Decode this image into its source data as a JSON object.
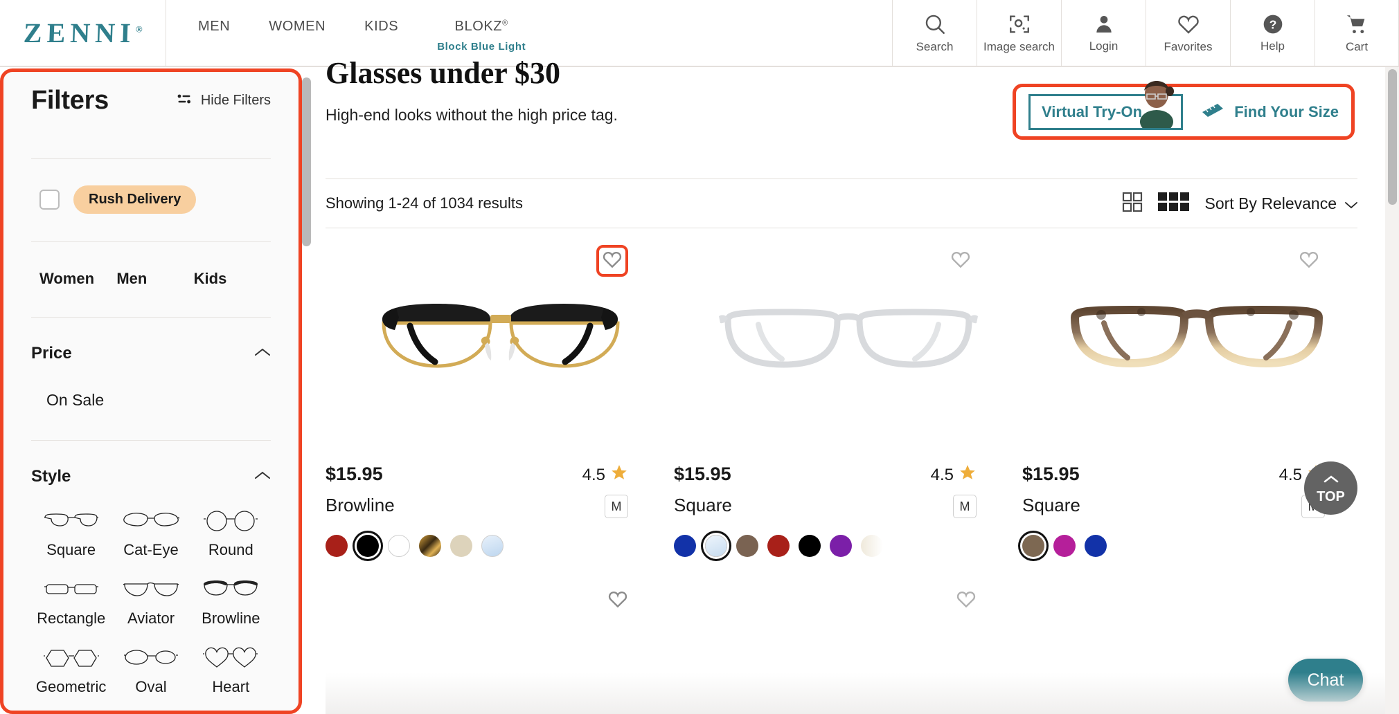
{
  "header": {
    "logo": "ZENNI",
    "logo_mark": "registered-trademark",
    "nav": [
      {
        "label": "MEN",
        "sub": ""
      },
      {
        "label": "WOMEN",
        "sub": ""
      },
      {
        "label": "KIDS",
        "sub": ""
      },
      {
        "label": "BLOKZ",
        "sup": "®",
        "sub": "Block Blue Light"
      }
    ],
    "actions": [
      {
        "label": "Search",
        "icon": "search-icon"
      },
      {
        "label": "Image search",
        "icon": "image-search-icon"
      },
      {
        "label": "Login",
        "icon": "user-icon"
      },
      {
        "label": "Favorites",
        "icon": "heart-icon"
      },
      {
        "label": "Help",
        "icon": "help-circle-icon"
      },
      {
        "label": "Cart",
        "icon": "cart-icon"
      }
    ]
  },
  "sidebar": {
    "title": "Filters",
    "hide_label": "Hide Filters",
    "rush": {
      "label": "Rush Delivery",
      "checked": false
    },
    "genders": [
      "Women",
      "Men",
      "Kids"
    ],
    "sections": [
      {
        "title": "Price",
        "expanded": true,
        "options": [
          "On Sale"
        ]
      },
      {
        "title": "Style",
        "expanded": true
      }
    ],
    "styles": [
      {
        "label": "Square",
        "icon": "glasses-square-icon"
      },
      {
        "label": "Cat-Eye",
        "icon": "glasses-cateye-icon"
      },
      {
        "label": "Round",
        "icon": "glasses-round-icon"
      },
      {
        "label": "Rectangle",
        "icon": "glasses-rectangle-icon"
      },
      {
        "label": "Aviator",
        "icon": "glasses-aviator-icon"
      },
      {
        "label": "Browline",
        "icon": "glasses-browline-icon"
      },
      {
        "label": "Geometric",
        "icon": "glasses-geometric-icon"
      },
      {
        "label": "Oval",
        "icon": "glasses-oval-icon"
      },
      {
        "label": "Heart",
        "icon": "glasses-heart-icon"
      }
    ]
  },
  "main": {
    "title": "Glasses under $30",
    "subtitle": "High-end looks without the high price tag.",
    "virtual_try_on": "Virtual Try-On",
    "find_your_size": "Find Your Size",
    "results_text": "Showing 1-24 of 1034 results",
    "sort_label": "Sort By Relevance",
    "view_modes": [
      "grid-2-icon",
      "grid-3-icon"
    ]
  },
  "products": [
    {
      "price": "$15.95",
      "rating": "4.5",
      "shape": "Browline",
      "size": "M",
      "favorited": false,
      "highlighted": true,
      "frame": "browline-black-gold",
      "colors": [
        {
          "hex": "#a82019",
          "selected": false
        },
        {
          "hex": "#000000",
          "selected": true
        },
        {
          "hex": "#ffffff",
          "selected": false
        },
        {
          "hex": "#c99536",
          "selected": false
        },
        {
          "hex": "#ddd3bb",
          "selected": false
        },
        {
          "hex": "#cfe2f3",
          "selected": false
        }
      ]
    },
    {
      "price": "$15.95",
      "rating": "4.5",
      "shape": "Square",
      "size": "M",
      "favorited": false,
      "highlighted": false,
      "frame": "square-clear",
      "colors": [
        {
          "hex": "#1232a8",
          "selected": false
        },
        {
          "hex": "#d2e4f5",
          "selected": true
        },
        {
          "hex": "#7a6352",
          "selected": false
        },
        {
          "hex": "#a82019",
          "selected": false
        },
        {
          "hex": "#000000",
          "selected": false
        },
        {
          "hex": "#7b1fa8",
          "selected": false
        },
        {
          "hex": "#f1ece0",
          "selected": false
        }
      ]
    },
    {
      "price": "$15.95",
      "rating": "4.5",
      "shape": "Square",
      "size": "M",
      "favorited": false,
      "highlighted": false,
      "frame": "square-tortoise",
      "colors": [
        {
          "hex": "#7d6852",
          "selected": true
        },
        {
          "hex": "#b51f9a",
          "selected": false
        },
        {
          "hex": "#1232a8",
          "selected": false
        }
      ]
    }
  ],
  "floating": {
    "top_label": "TOP",
    "chat_label": "Chat"
  },
  "colors": {
    "brand_teal": "#2f7f8c",
    "highlight_red": "#ef4323",
    "star_gold": "#eead3a",
    "pill_peach": "#f8cf9f"
  }
}
